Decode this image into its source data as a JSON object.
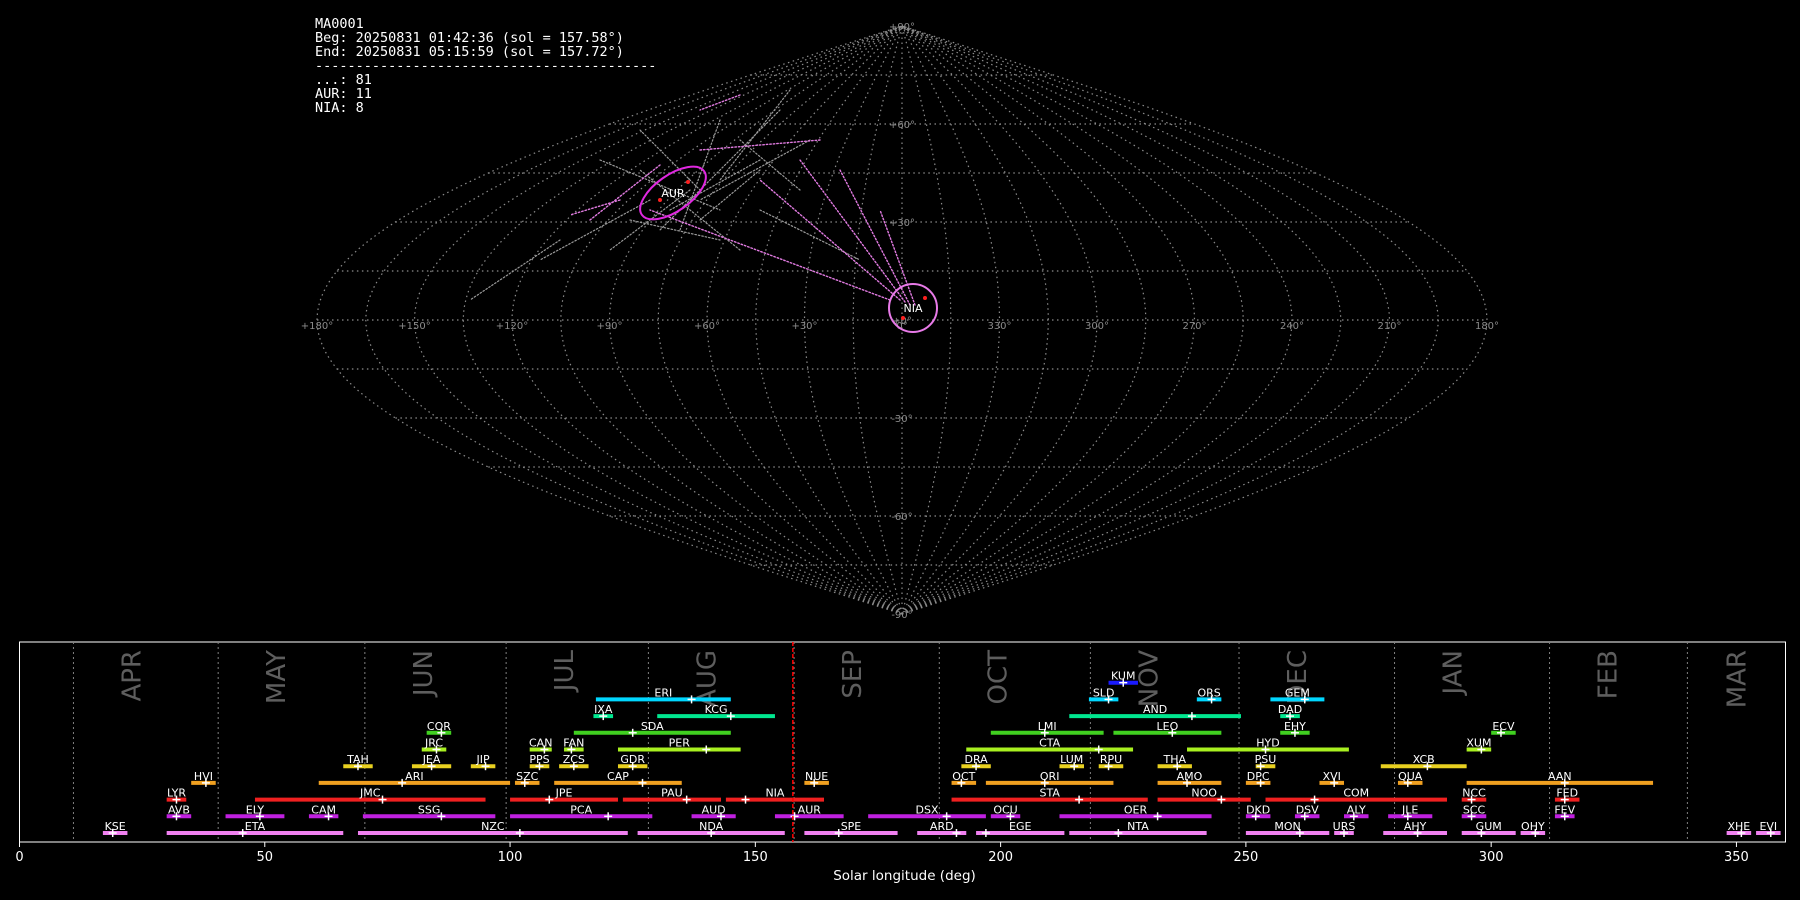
{
  "header": {
    "station": "MA0001",
    "begin": "Beg: 20250831 01:42:36 (sol = 157.58°)",
    "end": "End: 20250831 05:15:59 (sol = 157.72°)",
    "separator": "------------------------------------------",
    "counts": [
      "...: 81",
      "AUR: 11",
      "NIA: 8"
    ]
  },
  "sky_map": {
    "projection": "sinusoidal",
    "lon_labels": [
      "+180°",
      "+150°",
      "+120°",
      "+90°",
      "+60°",
      "+30°",
      "0°",
      "330°",
      "300°",
      "270°",
      "240°",
      "210°",
      "180°"
    ],
    "lat_labels": [
      "+90°",
      "+60°",
      "+30°",
      "+0°",
      "-30°",
      "-60°",
      "-90°"
    ],
    "radiants": [
      {
        "label": "AUR",
        "color": "#e028e0"
      },
      {
        "label": "NIA",
        "color": "#e87ae8"
      }
    ]
  },
  "chart_data": {
    "type": "timeline",
    "xlabel": "Solar longitude (deg)",
    "xlim": [
      0,
      360
    ],
    "xticks": [
      0,
      50,
      100,
      150,
      200,
      250,
      300,
      350
    ],
    "current_sol": 157.65,
    "months": [
      {
        "label": "APR",
        "start": 11.0
      },
      {
        "label": "MAY",
        "start": 40.5
      },
      {
        "label": "JUN",
        "start": 70.4
      },
      {
        "label": "JUL",
        "start": 99.2
      },
      {
        "label": "AUG",
        "start": 128.2
      },
      {
        "label": "SEP",
        "start": 157.9
      },
      {
        "label": "OCT",
        "start": 187.5
      },
      {
        "label": "NOV",
        "start": 218.3
      },
      {
        "label": "DEC",
        "start": 248.6
      },
      {
        "label": "JAN",
        "start": 280.3
      },
      {
        "label": "FEB",
        "start": 311.9
      },
      {
        "label": "MAR",
        "start": 340.0
      }
    ],
    "showers": [
      {
        "code": "KUM",
        "row": 9,
        "start": 222,
        "end": 228,
        "peak": 225,
        "color": "#1a1aff"
      },
      {
        "code": "ERI",
        "row": 8,
        "start": 117.5,
        "end": 145,
        "peak": 137,
        "color": "#00d7ff"
      },
      {
        "code": "SLD",
        "row": 8,
        "start": 218,
        "end": 224,
        "peak": 222,
        "color": "#00d7ff"
      },
      {
        "code": "ORS",
        "row": 8,
        "start": 240,
        "end": 245,
        "peak": 243,
        "color": "#00d7ff"
      },
      {
        "code": "GEM",
        "row": 8,
        "start": 255,
        "end": 266,
        "peak": 262,
        "color": "#00d7ff"
      },
      {
        "code": "IXA",
        "row": 7,
        "start": 117,
        "end": 121,
        "peak": 119,
        "color": "#00e890"
      },
      {
        "code": "KCG",
        "row": 7,
        "start": 130,
        "end": 154,
        "peak": 145,
        "color": "#00e890"
      },
      {
        "code": "AND",
        "row": 7,
        "start": 214,
        "end": 249,
        "peak": 239,
        "color": "#00e890"
      },
      {
        "code": "DAD",
        "row": 7,
        "start": 257,
        "end": 261,
        "peak": 259,
        "color": "#00e890"
      },
      {
        "code": "COR",
        "row": 6,
        "start": 83,
        "end": 88,
        "peak": 86,
        "color": "#40d020"
      },
      {
        "code": "SDA",
        "row": 6,
        "start": 113,
        "end": 145,
        "peak": 125,
        "color": "#40d020"
      },
      {
        "code": "LMI",
        "row": 6,
        "start": 198,
        "end": 221,
        "peak": 209,
        "color": "#40d020"
      },
      {
        "code": "LEO",
        "row": 6,
        "start": 223,
        "end": 245,
        "peak": 235,
        "color": "#40d020"
      },
      {
        "code": "EHY",
        "row": 6,
        "start": 257,
        "end": 263,
        "peak": 260,
        "color": "#40d020"
      },
      {
        "code": "ECV",
        "row": 6,
        "start": 300,
        "end": 305,
        "peak": 302,
        "color": "#40d020"
      },
      {
        "code": "JRC",
        "row": 5,
        "start": 82,
        "end": 87,
        "peak": 85,
        "color": "#a8f020"
      },
      {
        "code": "CAN",
        "row": 5,
        "start": 104,
        "end": 108.5,
        "peak": 107,
        "color": "#a8f020"
      },
      {
        "code": "FAN",
        "row": 5,
        "start": 111,
        "end": 115,
        "peak": 112.5,
        "color": "#a8f020"
      },
      {
        "code": "PER",
        "row": 5,
        "start": 122,
        "end": 147,
        "peak": 140,
        "color": "#a8f020"
      },
      {
        "code": "CTA",
        "row": 5,
        "start": 193,
        "end": 227,
        "peak": 220,
        "color": "#a8f020"
      },
      {
        "code": "HYD",
        "row": 5,
        "start": 238,
        "end": 271,
        "peak": 254,
        "color": "#a8f020"
      },
      {
        "code": "XUM",
        "row": 5,
        "start": 295,
        "end": 300,
        "peak": 298,
        "color": "#a8f020"
      },
      {
        "code": "TAH",
        "row": 4,
        "start": 66,
        "end": 72,
        "peak": 69,
        "color": "#e8d020"
      },
      {
        "code": "JEA",
        "row": 4,
        "start": 80,
        "end": 88,
        "peak": 84,
        "color": "#e8d020"
      },
      {
        "code": "JIP",
        "row": 4,
        "start": 92,
        "end": 97,
        "peak": 95,
        "color": "#e8d020"
      },
      {
        "code": "PPS",
        "row": 4,
        "start": 104,
        "end": 108,
        "peak": 106,
        "color": "#e8d020"
      },
      {
        "code": "ZCS",
        "row": 4,
        "start": 110,
        "end": 116,
        "peak": 113,
        "color": "#e8d020"
      },
      {
        "code": "GDR",
        "row": 4,
        "start": 122,
        "end": 128,
        "peak": 125,
        "color": "#e8d020"
      },
      {
        "code": "DRA",
        "row": 4,
        "start": 192,
        "end": 198,
        "peak": 195,
        "color": "#e8d020"
      },
      {
        "code": "LUM",
        "row": 4,
        "start": 212,
        "end": 217,
        "peak": 215,
        "color": "#e8d020"
      },
      {
        "code": "RPU",
        "row": 4,
        "start": 220,
        "end": 225,
        "peak": 222,
        "color": "#e8d020"
      },
      {
        "code": "THA",
        "row": 4,
        "start": 232,
        "end": 239,
        "peak": 236,
        "color": "#e8d020"
      },
      {
        "code": "PSU",
        "row": 4,
        "start": 252,
        "end": 256,
        "peak": 253,
        "color": "#e8d020"
      },
      {
        "code": "XCB",
        "row": 4,
        "start": 277.5,
        "end": 295,
        "peak": 287,
        "color": "#e8d020"
      },
      {
        "code": "HVI",
        "row": 3,
        "start": 35,
        "end": 40,
        "peak": 38,
        "color": "#f0a020"
      },
      {
        "code": "ARI",
        "row": 3,
        "start": 61,
        "end": 100,
        "peak": 78,
        "color": "#f0a020"
      },
      {
        "code": "SZC",
        "row": 3,
        "start": 101,
        "end": 106,
        "peak": 103,
        "color": "#f0a020"
      },
      {
        "code": "CAP",
        "row": 3,
        "start": 109,
        "end": 135,
        "peak": 127,
        "color": "#f0a020"
      },
      {
        "code": "NUE",
        "row": 3,
        "start": 160,
        "end": 165,
        "peak": 162,
        "color": "#f0a020"
      },
      {
        "code": "OCT",
        "row": 3,
        "start": 190,
        "end": 195,
        "peak": 192,
        "color": "#f0a020"
      },
      {
        "code": "ORI",
        "row": 3,
        "start": 197,
        "end": 223,
        "peak": 209,
        "color": "#f0a020"
      },
      {
        "code": "AMO",
        "row": 3,
        "start": 232,
        "end": 245,
        "peak": 238,
        "color": "#f0a020"
      },
      {
        "code": "DPC",
        "row": 3,
        "start": 250,
        "end": 255,
        "peak": 253,
        "color": "#f0a020"
      },
      {
        "code": "XVI",
        "row": 3,
        "start": 265,
        "end": 270,
        "peak": 268,
        "color": "#f0a020"
      },
      {
        "code": "QUA",
        "row": 3,
        "start": 281,
        "end": 286,
        "peak": 283,
        "color": "#f0a020"
      },
      {
        "code": "AAN",
        "row": 3,
        "start": 295,
        "end": 333,
        "peak": 315,
        "color": "#f0a020"
      },
      {
        "code": "LYR",
        "row": 2,
        "start": 30,
        "end": 34,
        "peak": 32,
        "color": "#f02020"
      },
      {
        "code": "JMC",
        "row": 2,
        "start": 48,
        "end": 95,
        "peak": 74,
        "color": "#f02020"
      },
      {
        "code": "JPE",
        "row": 2,
        "start": 100,
        "end": 122,
        "peak": 108,
        "color": "#f02020"
      },
      {
        "code": "PAU",
        "row": 2,
        "start": 123,
        "end": 143,
        "peak": 136,
        "color": "#f02020"
      },
      {
        "code": "NIA",
        "row": 2,
        "start": 144,
        "end": 164,
        "peak": 148,
        "color": "#f02020"
      },
      {
        "code": "STA",
        "row": 2,
        "start": 190,
        "end": 230,
        "peak": 216,
        "color": "#f02020"
      },
      {
        "code": "NOO",
        "row": 2,
        "start": 232,
        "end": 251,
        "peak": 245,
        "color": "#f02020"
      },
      {
        "code": "COM",
        "row": 2,
        "start": 254,
        "end": 291,
        "peak": 264,
        "color": "#f02020"
      },
      {
        "code": "NCC",
        "row": 2,
        "start": 294,
        "end": 299,
        "peak": 296,
        "color": "#f02020"
      },
      {
        "code": "FED",
        "row": 2,
        "start": 313,
        "end": 318,
        "peak": 315,
        "color": "#f02020"
      },
      {
        "code": "AVB",
        "row": 1,
        "start": 30,
        "end": 35,
        "peak": 32,
        "color": "#c020e0"
      },
      {
        "code": "ELY",
        "row": 1,
        "start": 42,
        "end": 54,
        "peak": 49,
        "color": "#c020e0"
      },
      {
        "code": "CAM",
        "row": 1,
        "start": 59,
        "end": 65,
        "peak": 63,
        "color": "#c020e0"
      },
      {
        "code": "SSG",
        "row": 1,
        "start": 70,
        "end": 97,
        "peak": 86,
        "color": "#c020e0"
      },
      {
        "code": "PCA",
        "row": 1,
        "start": 100,
        "end": 129,
        "peak": 120,
        "color": "#c020e0"
      },
      {
        "code": "AUD",
        "row": 1,
        "start": 137,
        "end": 146,
        "peak": 143,
        "color": "#c020e0"
      },
      {
        "code": "AUR",
        "row": 1,
        "start": 154,
        "end": 168,
        "peak": 158,
        "color": "#c020e0"
      },
      {
        "code": "DSX",
        "row": 1,
        "start": 173,
        "end": 197,
        "peak": 189,
        "color": "#c020e0"
      },
      {
        "code": "OCU",
        "row": 1,
        "start": 198,
        "end": 204,
        "peak": 202,
        "color": "#c020e0"
      },
      {
        "code": "OER",
        "row": 1,
        "start": 212,
        "end": 243,
        "peak": 232,
        "color": "#c020e0"
      },
      {
        "code": "DKD",
        "row": 1,
        "start": 250,
        "end": 255,
        "peak": 252,
        "color": "#c020e0"
      },
      {
        "code": "DSV",
        "row": 1,
        "start": 260,
        "end": 265,
        "peak": 262,
        "color": "#c020e0"
      },
      {
        "code": "ALY",
        "row": 1,
        "start": 270,
        "end": 275,
        "peak": 272,
        "color": "#c020e0"
      },
      {
        "code": "JLE",
        "row": 1,
        "start": 279,
        "end": 288,
        "peak": 283,
        "color": "#c020e0"
      },
      {
        "code": "SCC",
        "row": 1,
        "start": 294,
        "end": 299,
        "peak": 296,
        "color": "#c020e0"
      },
      {
        "code": "FEV",
        "row": 1,
        "start": 313,
        "end": 317,
        "peak": 315,
        "color": "#c020e0"
      },
      {
        "code": "KSE",
        "row": 0,
        "start": 17,
        "end": 22,
        "peak": 19,
        "color": "#f080f0"
      },
      {
        "code": "ETA",
        "row": 0,
        "start": 30,
        "end": 66,
        "peak": 45.5,
        "color": "#f080f0"
      },
      {
        "code": "NZC",
        "row": 0,
        "start": 69,
        "end": 124,
        "peak": 102,
        "color": "#f080f0"
      },
      {
        "code": "NDA",
        "row": 0,
        "start": 126,
        "end": 156,
        "peak": 141,
        "color": "#f080f0"
      },
      {
        "code": "SPE",
        "row": 0,
        "start": 160,
        "end": 179,
        "peak": 167,
        "color": "#f080f0"
      },
      {
        "code": "ARD",
        "row": 0,
        "start": 183,
        "end": 193,
        "peak": 191,
        "color": "#f080f0"
      },
      {
        "code": "EGE",
        "row": 0,
        "start": 195,
        "end": 213,
        "peak": 197,
        "color": "#f080f0"
      },
      {
        "code": "NTA",
        "row": 0,
        "start": 214,
        "end": 242,
        "peak": 224,
        "color": "#f080f0"
      },
      {
        "code": "MON",
        "row": 0,
        "start": 250,
        "end": 267,
        "peak": 261,
        "color": "#f080f0"
      },
      {
        "code": "URS",
        "row": 0,
        "start": 268,
        "end": 272,
        "peak": 270,
        "color": "#f080f0"
      },
      {
        "code": "AHY",
        "row": 0,
        "start": 278,
        "end": 291,
        "peak": 285,
        "color": "#f080f0"
      },
      {
        "code": "GUM",
        "row": 0,
        "start": 294,
        "end": 305,
        "peak": 298,
        "color": "#f080f0"
      },
      {
        "code": "OHY",
        "row": 0,
        "start": 306,
        "end": 311,
        "peak": 309,
        "color": "#f080f0"
      },
      {
        "code": "XHE",
        "row": 0,
        "start": 348,
        "end": 353,
        "peak": 351,
        "color": "#f080f0"
      },
      {
        "code": "EVI",
        "row": 0,
        "start": 354,
        "end": 359,
        "peak": 357,
        "color": "#f080f0"
      }
    ]
  }
}
